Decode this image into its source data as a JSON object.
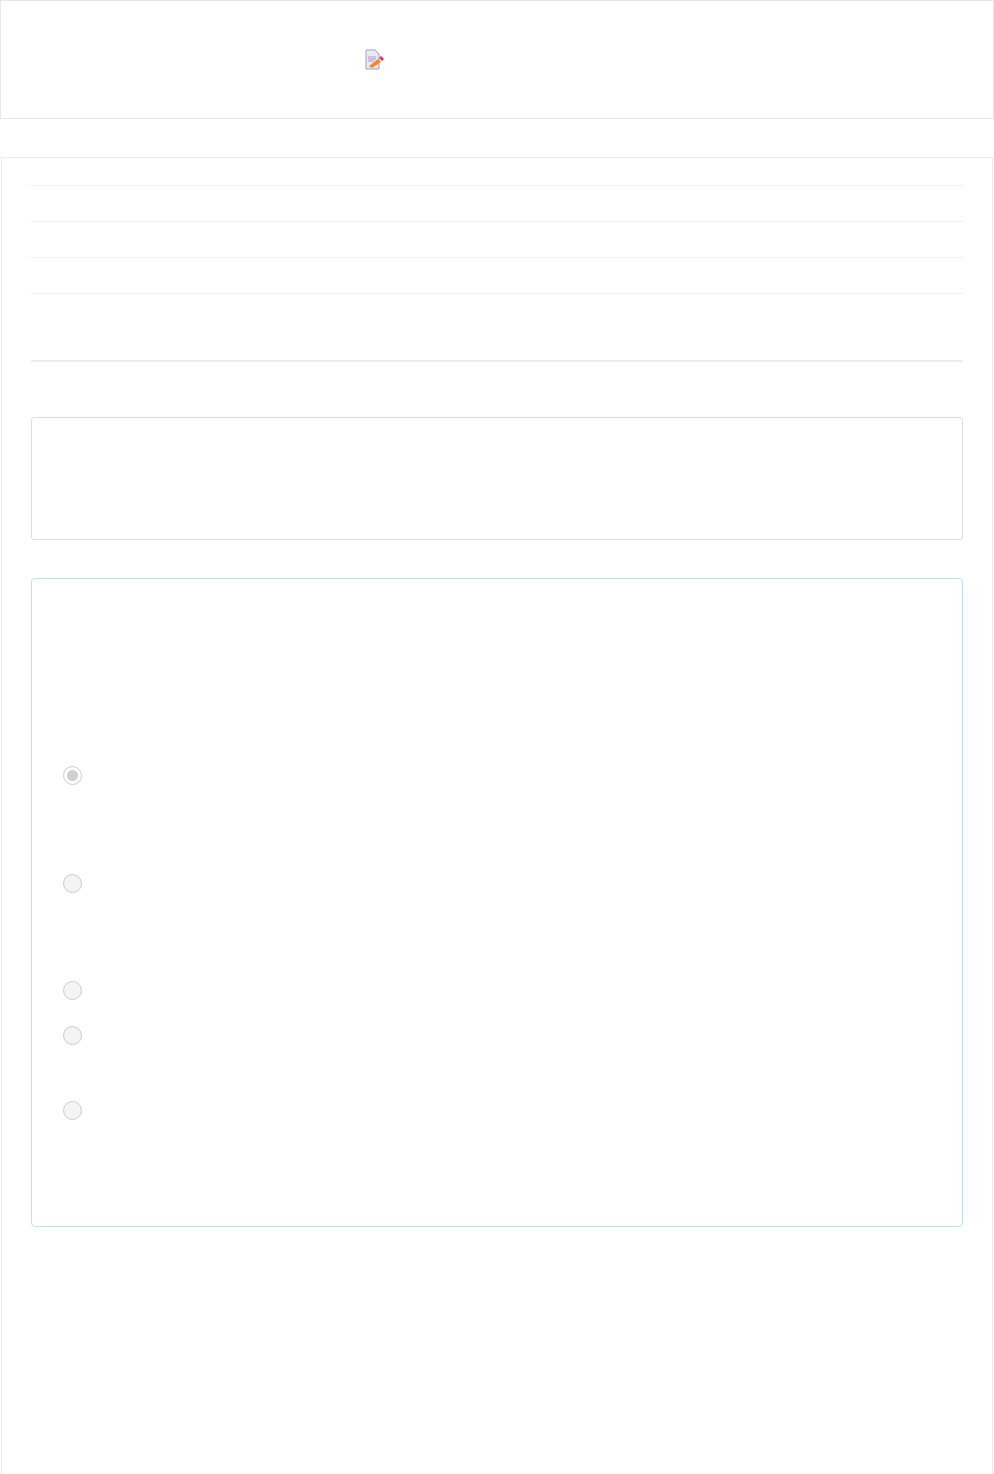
{
  "question": {
    "options": [
      {
        "selected": true
      },
      {
        "selected": false
      },
      {
        "selected": false
      },
      {
        "selected": false
      },
      {
        "selected": false
      }
    ]
  }
}
